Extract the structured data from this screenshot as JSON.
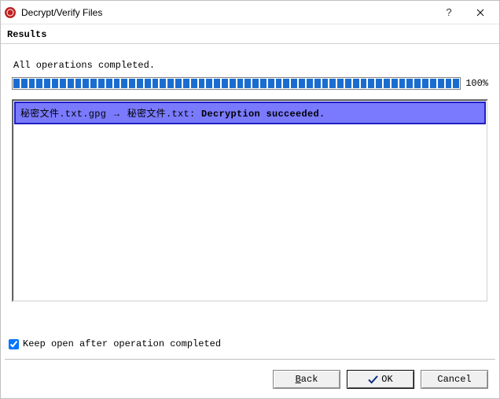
{
  "window": {
    "title": "Decrypt/Verify Files"
  },
  "header": {
    "section_title": "Results"
  },
  "main": {
    "status_text": "All operations completed.",
    "progress_percent": "100%",
    "results": [
      {
        "source": "秘密文件.txt.gpg",
        "arrow": "→",
        "dest": "秘密文件.txt:",
        "status": "Decryption succeeded."
      }
    ]
  },
  "options": {
    "keep_open_label": "Keep open after operation completed",
    "keep_open_checked": true
  },
  "buttons": {
    "back": "Back",
    "ok": "OK",
    "cancel": "Cancel"
  }
}
